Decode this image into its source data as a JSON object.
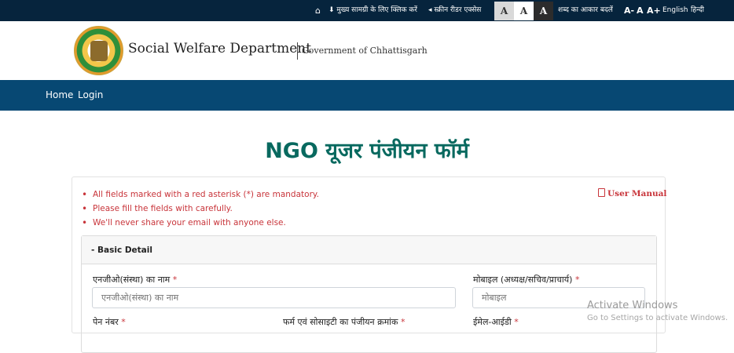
{
  "topbar": {
    "skip_main": "मुख्य सामग्री के लिए क्लिक करें",
    "screen_reader": "स्क्रीन रीडर एक्सेस",
    "contrast": [
      "A",
      "A",
      "A"
    ],
    "text_size_label": "शब्द का आकार बदलें",
    "size_small": "A-",
    "size_normal": "A",
    "size_large": "A+",
    "lang_english": "English",
    "lang_hindi": "हिन्दी"
  },
  "header": {
    "brand": "Social Welfare Department",
    "gov": "Government of Chhattisgarh"
  },
  "nav": {
    "home": "Home",
    "login": "Login"
  },
  "page_title": "NGO यूजर पंजीयन फॉर्म",
  "notes": [
    "All fields marked with a red asterisk (*) are mandatory.",
    "Please fill the fields with carefully.",
    "We'll never share your email with anyone else."
  ],
  "user_manual": "User Manual",
  "section": {
    "title": "- Basic Detail",
    "fields": {
      "ngo_name_label": "एनजीओ(संस्था) का नाम",
      "ngo_name_placeholder": "एनजीओ(संस्था) का नाम",
      "mobile_label": "मोबाइल (अध्यक्ष/सचिव/प्राचार्य)",
      "mobile_placeholder": "मोबाइल",
      "pan_label": "पेन नंबर",
      "firm_reg_label": "फर्म एवं सोसाइटी का पंजीयन क्रमांक",
      "email_label": "ईमेल-आईडी"
    },
    "required_mark": "*"
  },
  "watermark": {
    "line1": "Activate Windows",
    "line2": "Go to Settings to activate Windows."
  },
  "colors": {
    "topbar": "#06243d",
    "nav": "#074873",
    "title": "#08695f",
    "required": "#c8343a"
  }
}
